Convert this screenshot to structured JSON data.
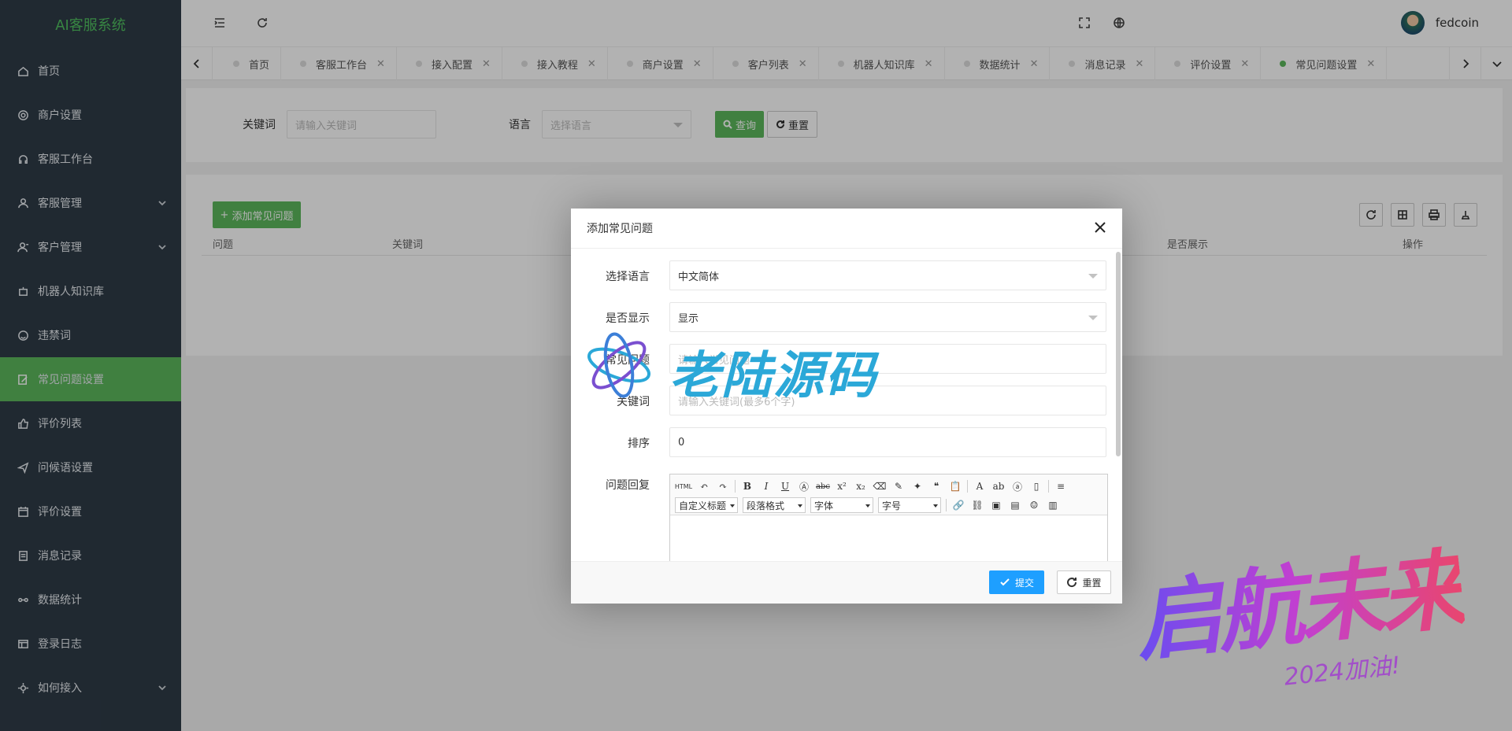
{
  "app": {
    "title": "AI客服系统"
  },
  "sidebar": {
    "items": [
      {
        "label": "首页",
        "icon": "home-icon",
        "has_children": false,
        "active": false
      },
      {
        "label": "商户设置",
        "icon": "gear-icon",
        "has_children": false,
        "active": false
      },
      {
        "label": "客服工作台",
        "icon": "headset-icon",
        "has_children": false,
        "active": false
      },
      {
        "label": "客服管理",
        "icon": "user-icon",
        "has_children": true,
        "active": false
      },
      {
        "label": "客户管理",
        "icon": "users-icon",
        "has_children": true,
        "active": false
      },
      {
        "label": "机器人知识库",
        "icon": "robot-icon",
        "has_children": false,
        "active": false
      },
      {
        "label": "违禁词",
        "icon": "face-icon",
        "has_children": false,
        "active": false
      },
      {
        "label": "常见问题设置",
        "icon": "edit-icon",
        "has_children": false,
        "active": true
      },
      {
        "label": "评价列表",
        "icon": "thumb-icon",
        "has_children": false,
        "active": false
      },
      {
        "label": "问候语设置",
        "icon": "send-icon",
        "has_children": false,
        "active": false
      },
      {
        "label": "评价设置",
        "icon": "calendar-icon",
        "has_children": false,
        "active": false
      },
      {
        "label": "消息记录",
        "icon": "doc-icon",
        "has_children": false,
        "active": false
      },
      {
        "label": "数据统计",
        "icon": "chart-icon",
        "has_children": false,
        "active": false
      },
      {
        "label": "登录日志",
        "icon": "log-icon",
        "has_children": false,
        "active": false
      },
      {
        "label": "如何接入",
        "icon": "plug-icon",
        "has_children": true,
        "active": false
      }
    ]
  },
  "header": {
    "username": "fedcoin"
  },
  "tabs": [
    {
      "label": "首页",
      "closable": false,
      "active": false
    },
    {
      "label": "客服工作台",
      "closable": true,
      "active": false
    },
    {
      "label": "接入配置",
      "closable": true,
      "active": false
    },
    {
      "label": "接入教程",
      "closable": true,
      "active": false
    },
    {
      "label": "商户设置",
      "closable": true,
      "active": false
    },
    {
      "label": "客户列表",
      "closable": true,
      "active": false
    },
    {
      "label": "机器人知识库",
      "closable": true,
      "active": false
    },
    {
      "label": "数据统计",
      "closable": true,
      "active": false
    },
    {
      "label": "消息记录",
      "closable": true,
      "active": false
    },
    {
      "label": "评价设置",
      "closable": true,
      "active": false
    },
    {
      "label": "常见问题设置",
      "closable": true,
      "active": true
    }
  ],
  "tab_close_glyph": "✕",
  "search": {
    "keyword_label": "关键词",
    "keyword_placeholder": "请输入关键词",
    "language_label": "语言",
    "language_placeholder": "选择语言",
    "query_button": "查询",
    "reset_button": "重置"
  },
  "table": {
    "add_button": "添加常见问题",
    "columns": [
      "问题",
      "关键词",
      "是否展示",
      "操作"
    ]
  },
  "modal": {
    "title": "添加常见问题",
    "fields": {
      "language_label": "选择语言",
      "language_value": "中文简体",
      "show_label": "是否显示",
      "show_value": "显示",
      "question_label": "常见问题",
      "question_placeholder": "请输入常见问题",
      "keywords_label": "关键词",
      "keywords_placeholder": "请输入关键词(最多6个字)",
      "sort_label": "排序",
      "sort_value": "0",
      "reply_label": "问题回复"
    },
    "editor": {
      "html_label": "HTML",
      "heading_select": "自定义标题",
      "paragraph_select": "段落格式",
      "font_select": "字体",
      "size_select": "字号"
    },
    "submit_button": "提交",
    "reset_button": "重置"
  },
  "watermarks": {
    "center": "老陆源码",
    "corner_main": "启航未来",
    "corner_sub": "2024加油!"
  },
  "colors": {
    "sidebar_bg": "#2f3b47",
    "accent_green": "#5cb85c",
    "primary_blue": "#1e9fff"
  }
}
